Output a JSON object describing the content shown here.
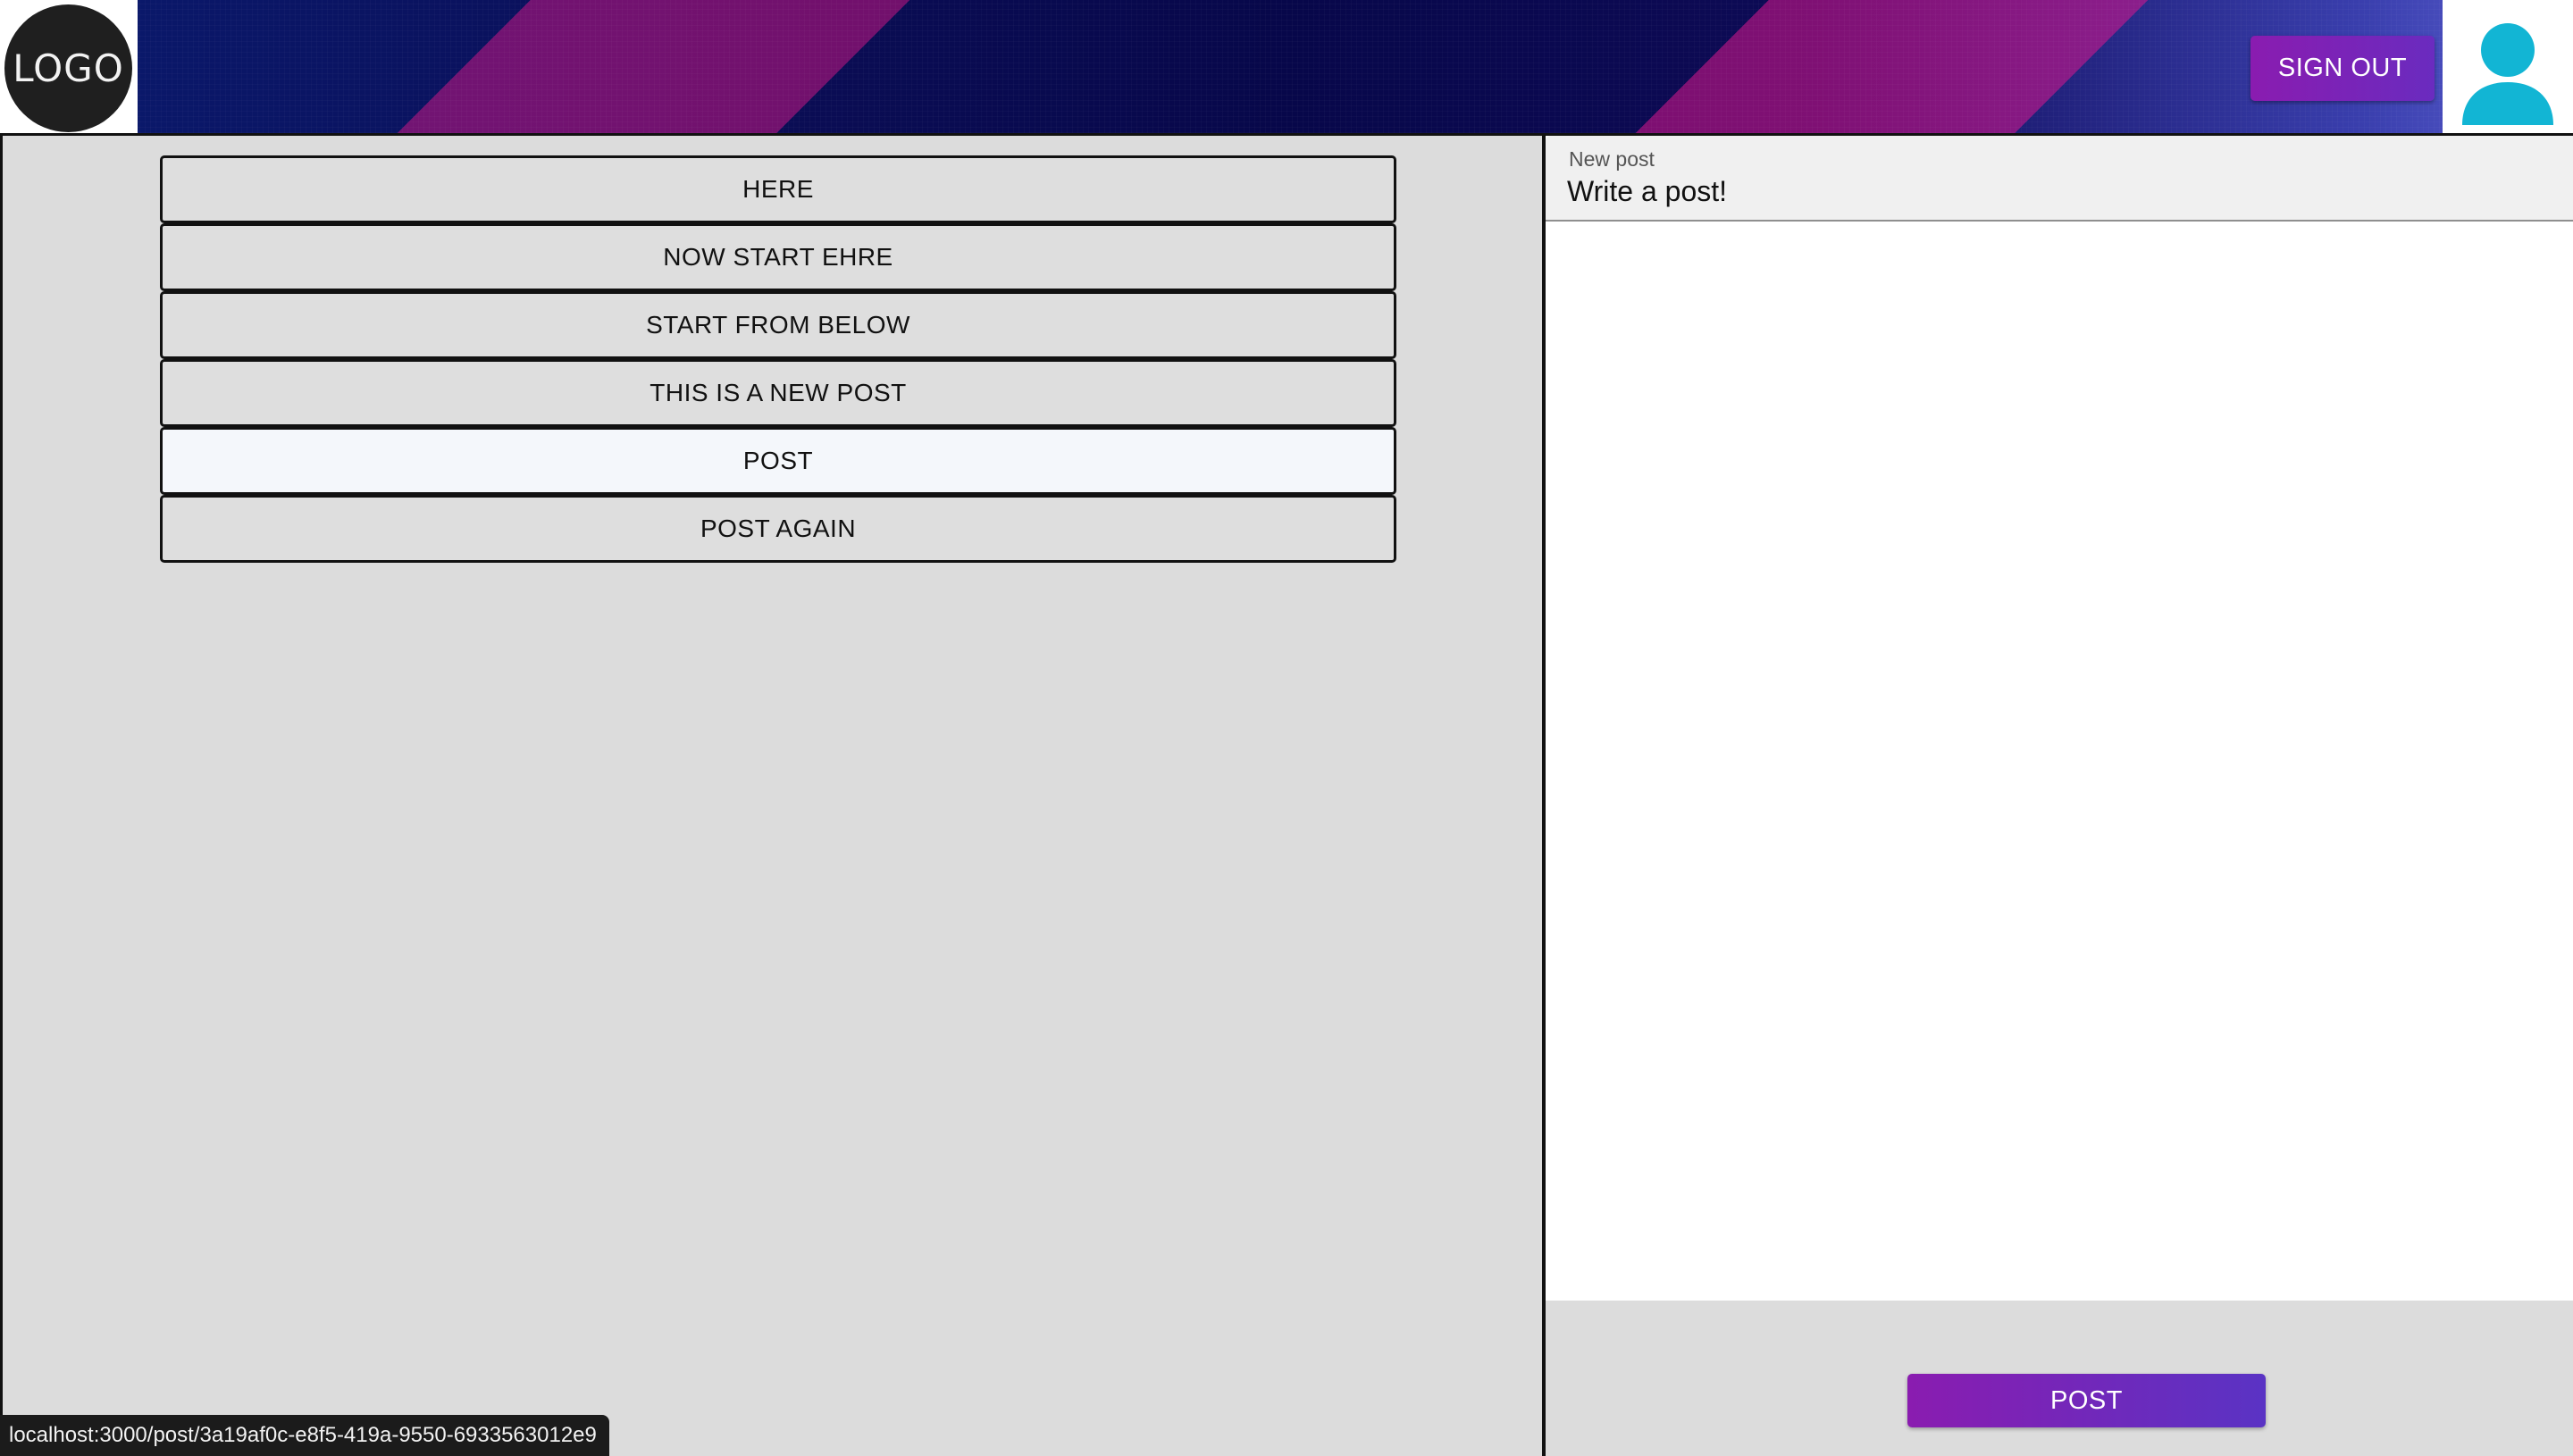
{
  "header": {
    "logo_text": "LOGO",
    "signout_label": "SIGN OUT",
    "avatar_icon": "user-avatar-icon"
  },
  "posts": [
    {
      "label": "HERE"
    },
    {
      "label": "NOW START EHRE"
    },
    {
      "label": "START FROM BELOW"
    },
    {
      "label": "THIS IS A NEW POST"
    },
    {
      "label": "POST",
      "active": true
    },
    {
      "label": "POST AGAIN"
    }
  ],
  "composer": {
    "label": "New post",
    "placeholder": "Write a post!",
    "value": "",
    "submit_label": "POST"
  },
  "status_bar": {
    "url": "localhost:3000/post/3a19af0c-e8f5-419a-9550-6933563012e9"
  },
  "colors": {
    "accent_gradient_start": "#8a1cb0",
    "accent_gradient_end": "#5a33c4",
    "avatar": "#12b5d4",
    "panel_bg": "#dcdcdc",
    "active_item_bg": "#f4f7fb"
  }
}
